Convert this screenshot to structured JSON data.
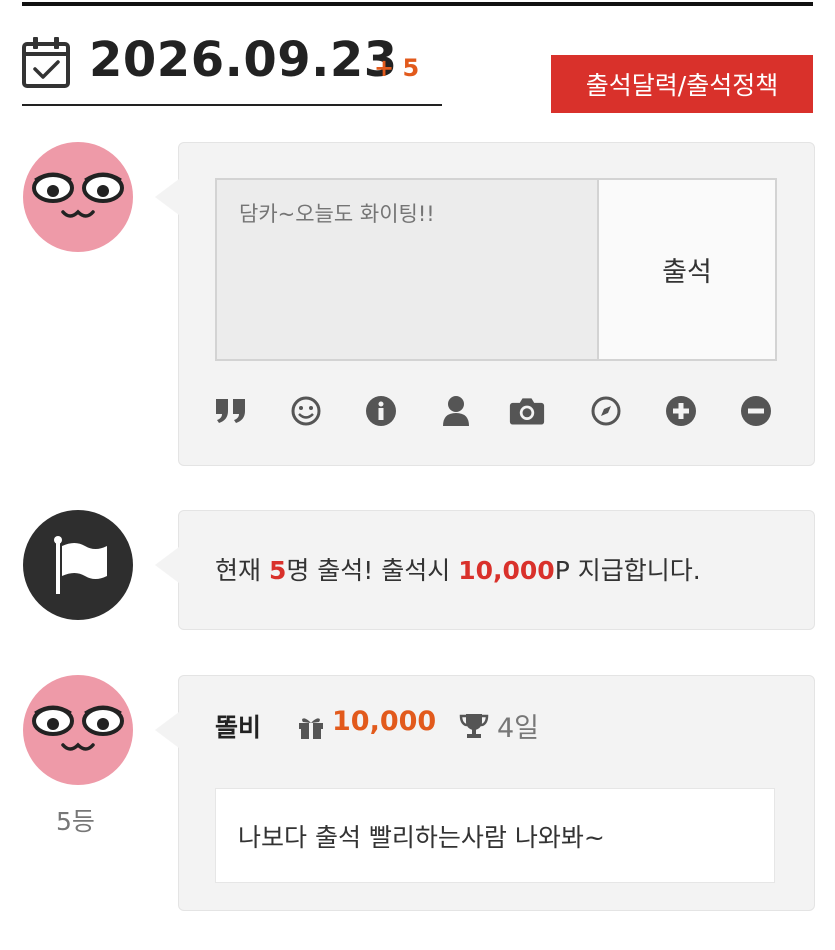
{
  "date": {
    "value": "2026.09.23",
    "plus": "+ 5",
    "calendar_icon": "calendar-check-icon"
  },
  "policy_button": {
    "label": "출석달력/출석정책",
    "color": "#d9312b"
  },
  "compose": {
    "placeholder": "담카~오늘도 화이팅!!",
    "submit_label": "출석",
    "tools": [
      "quote-icon",
      "smiley-icon",
      "info-icon",
      "user-icon",
      "camera-icon",
      "compass-icon",
      "plus-circle-icon",
      "minus-circle-icon"
    ]
  },
  "notice": {
    "pre": "현재 ",
    "count": "5",
    "mid": "명 출석! 출석시 ",
    "points": "10,000",
    "post": "P 지급합니다.",
    "icon": "flag-icon"
  },
  "entry": {
    "name": "똘비",
    "points": "10,000",
    "days": "4일",
    "message": "나보다 출석 빨리하는사람 나와봐~",
    "rank": "5등",
    "accent": "#e25a1c"
  }
}
